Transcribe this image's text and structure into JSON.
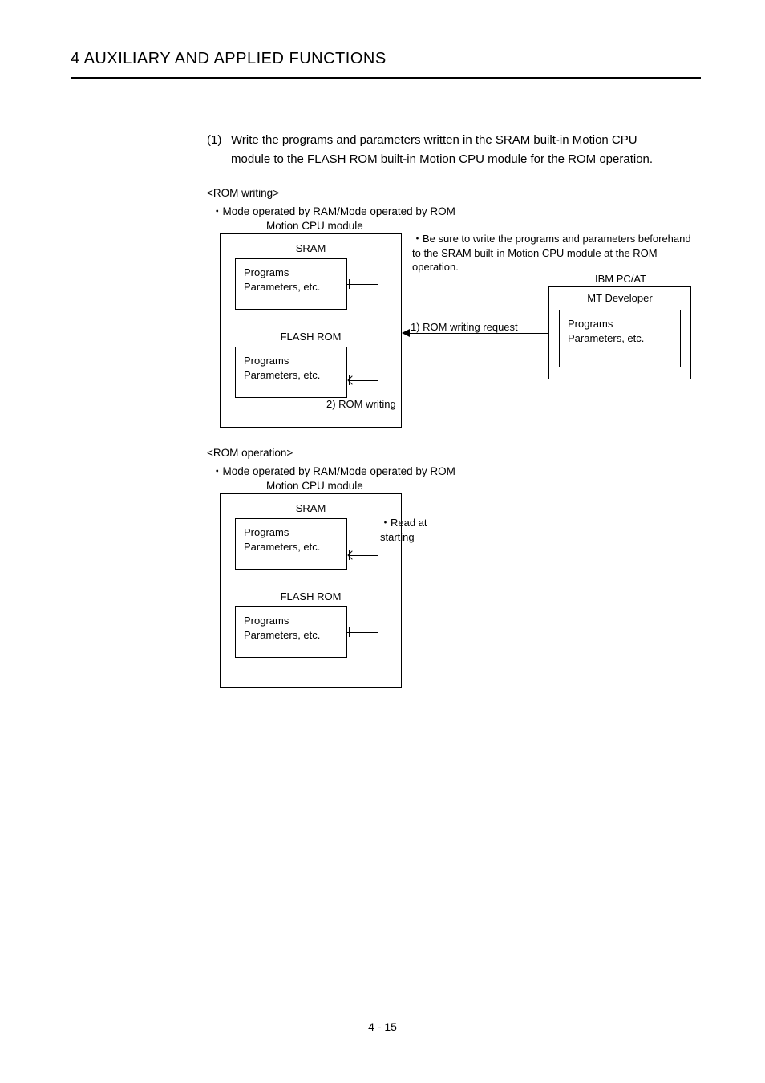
{
  "header": "4   AUXILIARY AND APPLIED FUNCTIONS",
  "item1": {
    "num": "(1)",
    "text": "Write the programs and parameters written in the SRAM built-in Motion CPU module to the FLASH ROM built-in Motion CPU module for the ROM operation."
  },
  "romWriting": {
    "title": "<ROM writing>",
    "mode": "Mode operated by RAM/Mode operated by ROM",
    "moduleTitle": "Motion CPU module",
    "sram": "SRAM",
    "flash": "FLASH ROM",
    "box1": "Programs\nParameters, etc.",
    "box2": "Programs\nParameters, etc.",
    "romWritingLabel": "2) ROM writing",
    "note": "Be sure to write the programs and parameters beforehand to the SRAM built-in Motion CPU module at the ROM operation.",
    "ibm": "IBM PC/AT",
    "mt": "MT Developer",
    "box3": "Programs\nParameters, etc.",
    "request": "1) ROM writing request"
  },
  "romOperation": {
    "title": "<ROM operation>",
    "mode": "Mode operated by RAM/Mode operated by ROM",
    "moduleTitle": "Motion CPU module",
    "sram": "SRAM",
    "flash": "FLASH ROM",
    "box1": "Programs\nParameters, etc.",
    "box2": "Programs\nParameters, etc.",
    "read": "Read at starting"
  },
  "pageNum": "4 - 15"
}
